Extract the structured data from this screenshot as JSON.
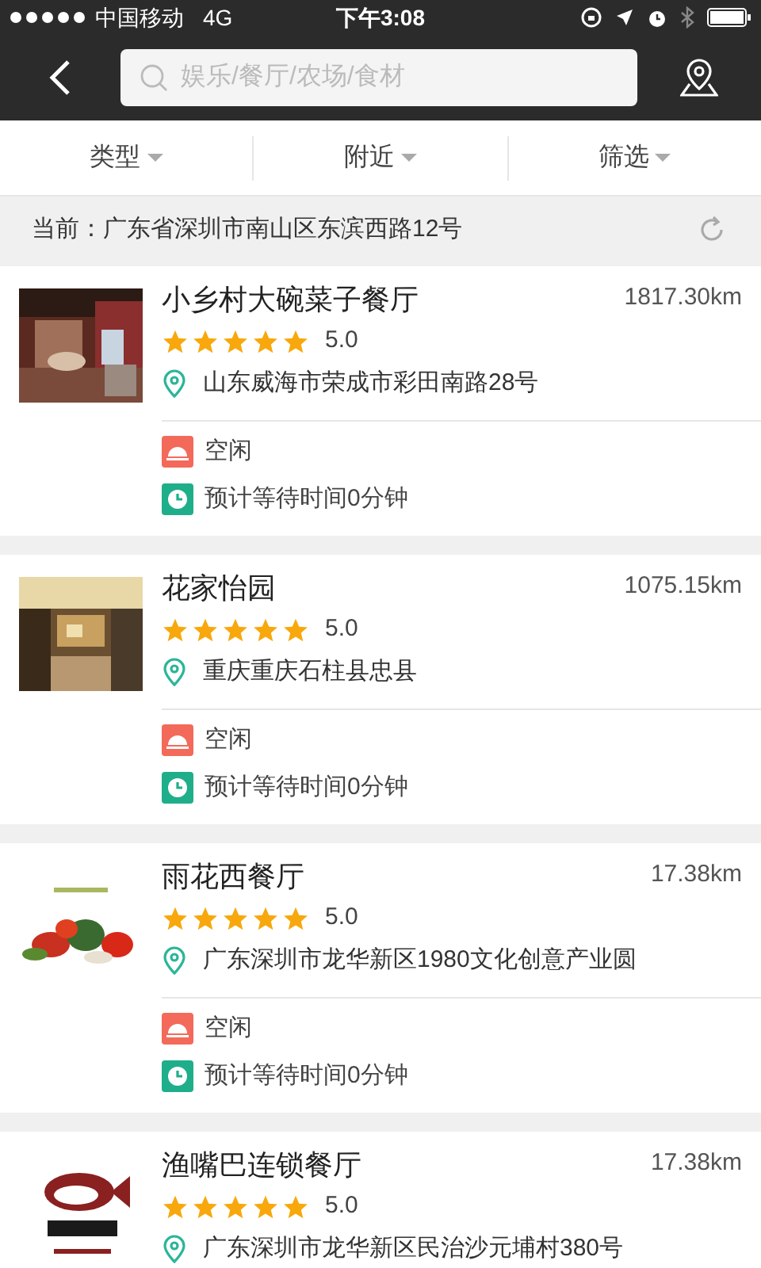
{
  "status_bar": {
    "carrier": "中国移动",
    "network": "4G",
    "time": "下午3:08"
  },
  "search": {
    "placeholder": "娱乐/餐厅/农场/食材"
  },
  "filters": [
    {
      "label": "类型"
    },
    {
      "label": "附近"
    },
    {
      "label": "筛选"
    }
  ],
  "current_location": "当前：广东省深圳市南山区东滨西路12号",
  "restaurants": [
    {
      "name": "小乡村大碗菜子餐厅",
      "distance": "1817.30km",
      "stars": 5,
      "rating": "5.0",
      "address": "山东威海市荣成市彩田南路28号",
      "status": "空闲",
      "wait": "预计等待时间0分钟",
      "kind": "picture"
    },
    {
      "name": "花家怡园",
      "distance": "1075.15km",
      "stars": 5,
      "rating": "5.0",
      "address": "重庆重庆石柱县忠县",
      "status": "空闲",
      "wait": "预计等待时间0分钟",
      "kind": "picture"
    },
    {
      "name": "雨花西餐厅",
      "distance": "17.38km",
      "stars": 5,
      "rating": "5.0",
      "address": "广东深圳市龙华新区1980文化创意产业圆",
      "status": "空闲",
      "wait": "预计等待时间0分钟",
      "kind": "picture"
    },
    {
      "name": "渔嘴巴连锁餐厅",
      "distance": "17.38km",
      "stars": 5,
      "rating": "5.0",
      "address": "广东深圳市龙华新区民治沙元埔村380号",
      "kind": "picture"
    }
  ]
}
